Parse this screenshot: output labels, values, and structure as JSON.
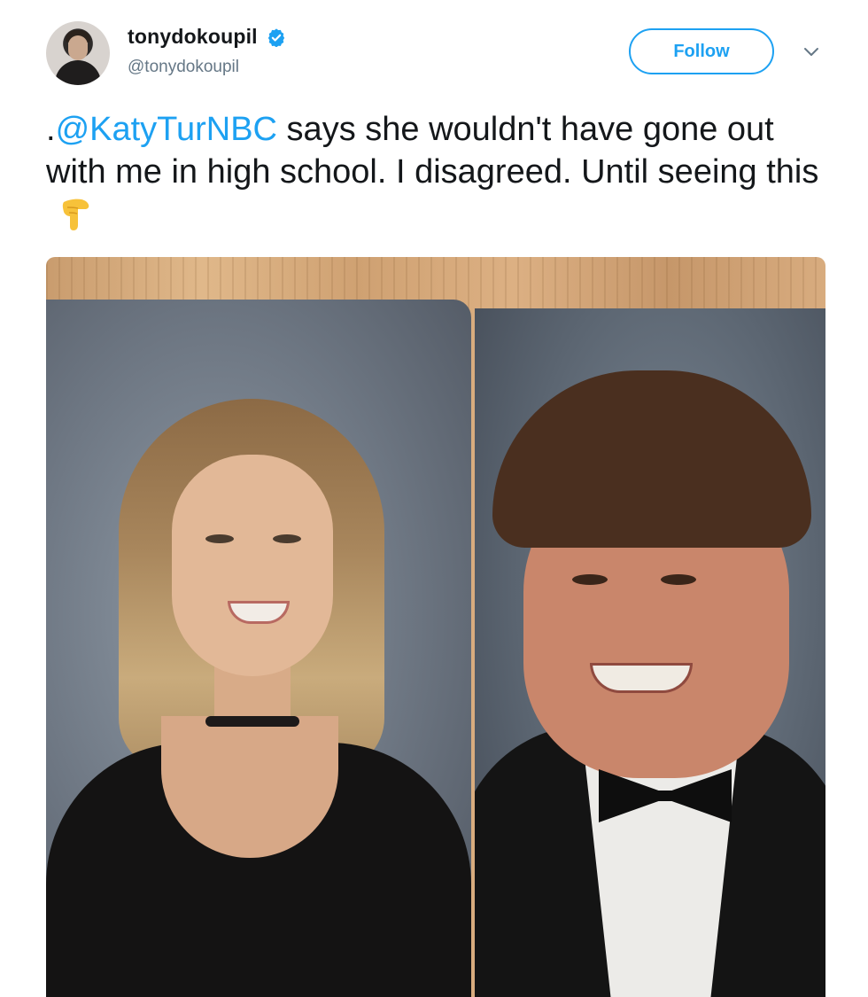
{
  "tweet": {
    "author": {
      "display_name": "tonydokoupil",
      "handle": "@tonydokoupil",
      "verified": true,
      "avatar": "profile-photo"
    },
    "follow_label": "Follow",
    "menu_icon": "chevron-down-icon",
    "text_prefix": ".",
    "mention": "@KatyTurNBC",
    "text_body": " says she wouldn't have gone out with me in high school. I disagreed. Until seeing this",
    "emoji": "backhand-index-pointing-down",
    "media": {
      "description": "two yearbook portrait photos on a wooden table"
    }
  },
  "colors": {
    "accent": "#1da1f2",
    "text": "#14171a",
    "secondary_text": "#657786"
  }
}
